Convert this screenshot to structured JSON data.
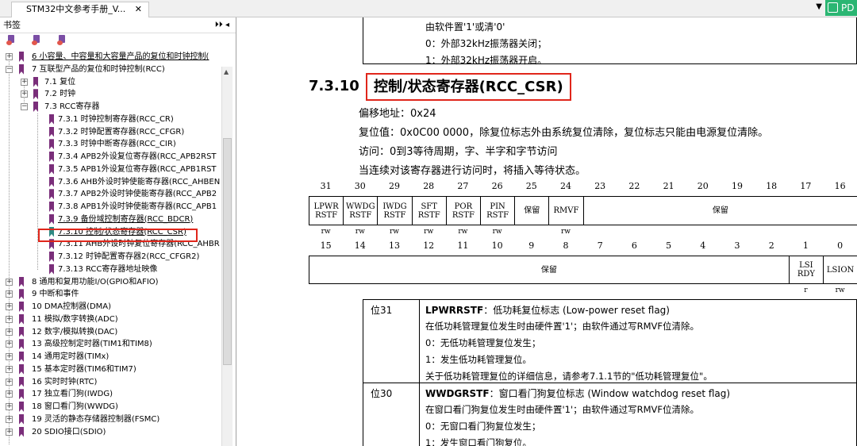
{
  "tab": {
    "title": "STM32中文参考手册_V..."
  },
  "toolbar": {
    "pdf_label": "PD"
  },
  "sidebar": {
    "header": "书签",
    "controls": "⏵⏵ ◂",
    "items": [
      {
        "text": "6 小容量、中容量和大容量产品的复位和时钟控制(",
        "ind": 0,
        "exp": "+",
        "u": true
      },
      {
        "text": "7 互联型产品的复位和时钟控制(RCC)",
        "ind": 0,
        "exp": "−"
      },
      {
        "text": "7.1 复位",
        "ind": 1,
        "exp": "+"
      },
      {
        "text": "7.2 时钟",
        "ind": 1,
        "exp": "+"
      },
      {
        "text": "7.3 RCC寄存器",
        "ind": 1,
        "exp": "−"
      },
      {
        "text": "7.3.1 时钟控制寄存器(RCC_CR)",
        "ind": 2
      },
      {
        "text": "7.3.2 时钟配置寄存器(RCC_CFGR)",
        "ind": 2
      },
      {
        "text": "7.3.3 时钟中断寄存器(RCC_CIR)",
        "ind": 2
      },
      {
        "text": "7.3.4 APB2外设复位寄存器(RCC_APB2RST",
        "ind": 2
      },
      {
        "text": "7.3.5 APB1外设复位寄存器(RCC_APB1RST",
        "ind": 2
      },
      {
        "text": "7.3.6 AHB外设时钟使能寄存器(RCC_AHBEN",
        "ind": 2
      },
      {
        "text": "7.3.7 APB2外设时钟使能寄存器(RCC_APB2",
        "ind": 2
      },
      {
        "text": "7.3.8 APB1外设时钟使能寄存器(RCC_APB1",
        "ind": 2
      },
      {
        "text": "7.3.9 备份域控制寄存器(RCC_BDCR)",
        "ind": 2,
        "u": true
      },
      {
        "text": "7.3.10 控制/状态寄存器(RCC_CSR)",
        "ind": 2,
        "sel": true,
        "u": true
      },
      {
        "text": "7.3.11 AHB外设时钟复位寄存器(RCC_AHBR",
        "ind": 2
      },
      {
        "text": "7.3.12 时钟配置寄存器2(RCC_CFGR2)",
        "ind": 2
      },
      {
        "text": "7.3.13 RCC寄存器地址映像",
        "ind": 2
      },
      {
        "text": "8 通用和复用功能I/O(GPIO和AFIO)",
        "ind": 0,
        "exp": "+"
      },
      {
        "text": "9 中断和事件",
        "ind": 0,
        "exp": "+"
      },
      {
        "text": "10 DMA控制器(DMA)",
        "ind": 0,
        "exp": "+"
      },
      {
        "text": "11 模拟/数字转换(ADC)",
        "ind": 0,
        "exp": "+"
      },
      {
        "text": "12 数字/模拟转换(DAC)",
        "ind": 0,
        "exp": "+"
      },
      {
        "text": "13 高级控制定时器(TIM1和TIM8)",
        "ind": 0,
        "exp": "+"
      },
      {
        "text": "14 通用定时器(TIMx)",
        "ind": 0,
        "exp": "+"
      },
      {
        "text": "15 基本定时器(TIM6和TIM7)",
        "ind": 0,
        "exp": "+"
      },
      {
        "text": "16 实时时钟(RTC)",
        "ind": 0,
        "exp": "+"
      },
      {
        "text": "17 独立看门狗(IWDG)",
        "ind": 0,
        "exp": "+"
      },
      {
        "text": "18 窗口看门狗(WWDG)",
        "ind": 0,
        "exp": "+"
      },
      {
        "text": "19 灵活的静态存储器控制器(FSMC)",
        "ind": 0,
        "exp": "+"
      },
      {
        "text": "20 SDIO接口(SDIO)",
        "ind": 0,
        "exp": "+"
      }
    ]
  },
  "doc": {
    "top_lines": [
      "由软件置'1'或清'0'",
      "0：外部32kHz振荡器关闭；",
      "1：外部32kHz振荡器开启。"
    ],
    "section_num": "7.3.10",
    "section_title": "控制/状态寄存器(RCC_CSR)",
    "info": [
      "偏移地址：0x24",
      "复位值：0x0C00 0000，除复位标志外由系统复位清除，复位标志只能由电源复位清除。",
      "访问：0到3等待周期，字、半字和字节访问",
      "当连续对该寄存器进行访问时，将插入等待状态。"
    ],
    "bits_high": [
      "31",
      "30",
      "29",
      "28",
      "27",
      "26",
      "25",
      "24",
      "23",
      "22",
      "21",
      "20",
      "19",
      "18",
      "17",
      "16"
    ],
    "bits_low": [
      "15",
      "14",
      "13",
      "12",
      "11",
      "10",
      "9",
      "8",
      "7",
      "6",
      "5",
      "4",
      "3",
      "2",
      "1",
      "0"
    ],
    "fields_high": [
      {
        "l1": "LPWR",
        "l2": "RSTF"
      },
      {
        "l1": "WWDG",
        "l2": "RSTF"
      },
      {
        "l1": "IWDG",
        "l2": "RSTF"
      },
      {
        "l1": "SFT",
        "l2": "RSTF"
      },
      {
        "l1": "POR",
        "l2": "RSTF"
      },
      {
        "l1": "PIN",
        "l2": "RSTF"
      },
      {
        "l1": "保留",
        "l2": ""
      },
      {
        "l1": "RMVF",
        "l2": ""
      },
      {
        "l1": "保留",
        "l2": ""
      }
    ],
    "access_high": [
      "rw",
      "rw",
      "rw",
      "rw",
      "rw",
      "rw",
      "rw"
    ],
    "fields_low": [
      {
        "l1": "保留",
        "l2": ""
      },
      {
        "l1": "LSI",
        "l2": "RDY"
      },
      {
        "l1": "LSION",
        "l2": ""
      }
    ],
    "access_low": [
      "r",
      "rw"
    ],
    "desc": [
      {
        "bit": "位31",
        "name": "LPWRRSTF",
        "title": "：低功耗复位标志 (Low-power reset flag)",
        "lines": [
          "在低功耗管理复位发生时由硬件置'1'；由软件通过写RMVF位清除。",
          "0：无低功耗管理复位发生；",
          "1：发生低功耗管理复位。",
          "关于低功耗管理复位的详细信息，请参考7.1.1节的\"低功耗管理复位\"。"
        ]
      },
      {
        "bit": "位30",
        "name": "WWDGRSTF",
        "title": "：窗口看门狗复位标志 (Window watchdog reset flag)",
        "lines": [
          "在窗口看门狗复位发生时由硬件置'1'；由软件通过写RMVF位清除。",
          "0：无窗口看门狗复位发生；",
          "1：发生窗口看门狗复位。"
        ]
      }
    ]
  }
}
